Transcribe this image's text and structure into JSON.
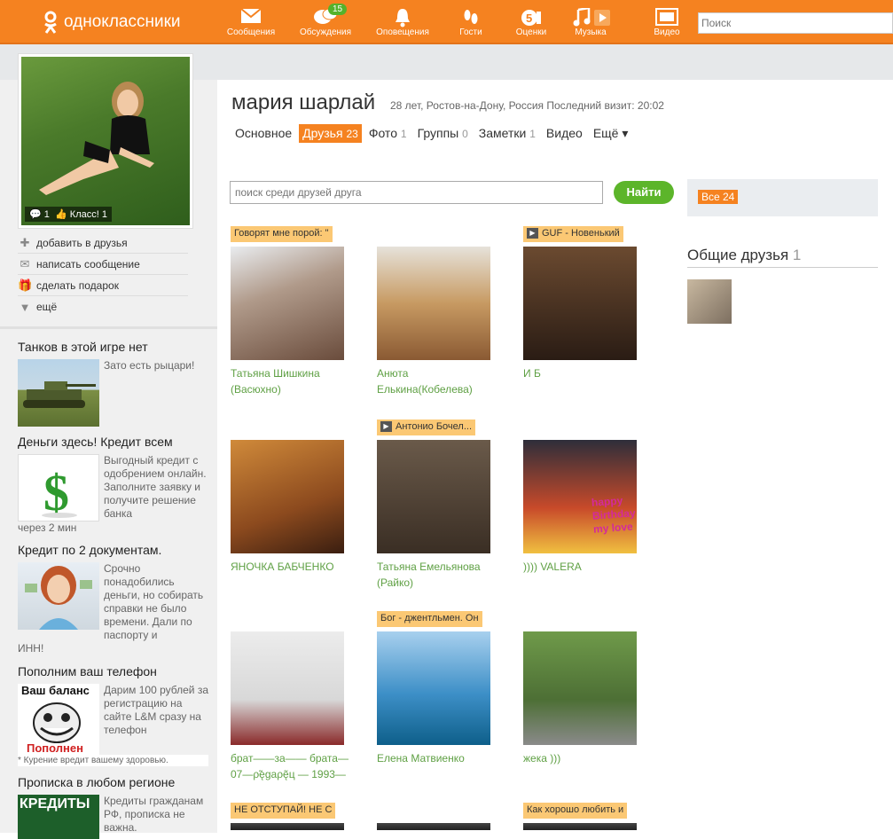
{
  "topbar": {
    "logo_text": "одноклассники",
    "nav": [
      {
        "label": "Сообщения",
        "icon": "envelope-icon"
      },
      {
        "label": "Обсуждения",
        "icon": "chat-bubbles-icon",
        "badge": "15"
      },
      {
        "label": "Оповещения",
        "icon": "bell-icon"
      },
      {
        "label": "Гости",
        "icon": "footprints-icon"
      },
      {
        "label": "Оценки",
        "icon": "rating-5-icon",
        "badge_inline": "5"
      },
      {
        "label": "Музыка",
        "icon": "music-note-icon"
      },
      {
        "label": "Видео",
        "icon": "video-icon"
      }
    ],
    "search_placeholder": "Поиск"
  },
  "profile": {
    "name": "мария шарлай",
    "meta": "28 лет, Ростов-на-Дону, Россия  Последний визит: 20:02",
    "photo_comments": "1",
    "photo_class": "Класс! 1",
    "actions": [
      {
        "label": "добавить в друзья",
        "icon": "plus-icon"
      },
      {
        "label": "написать сообщение",
        "icon": "envelope-icon"
      },
      {
        "label": "сделать подарок",
        "icon": "gift-icon"
      },
      {
        "label": "ещё",
        "icon": "triangle-down-icon"
      }
    ]
  },
  "tabs": [
    {
      "label": "Основное",
      "count": ""
    },
    {
      "label": "Друзья",
      "count": "23",
      "active": true
    },
    {
      "label": "Фото",
      "count": "1"
    },
    {
      "label": "Группы",
      "count": "0"
    },
    {
      "label": "Заметки",
      "count": "1"
    },
    {
      "label": "Видео",
      "count": ""
    },
    {
      "label": "Ещё ▾",
      "count": ""
    }
  ],
  "friend_search": {
    "placeholder": "поиск среди друзей друга",
    "button": "Найти"
  },
  "right": {
    "all_label": "Все 24",
    "common_title": "Общие друзья",
    "common_count": "1"
  },
  "friends": [
    {
      "name": "Татьяна Шишкина (Васюхно)",
      "status": "Говорят мне порой: \"",
      "play": false
    },
    {
      "name": "Анюта Елькина(Кобелева)",
      "status": "",
      "play": false
    },
    {
      "name": "И Б",
      "status": "GUF - Новенький",
      "play": true
    },
    {
      "name": "ЯНОЧКА БАБЧЕНКО",
      "status": "",
      "play": false
    },
    {
      "name": "Татьяна Емельянова (Райко)",
      "status": "Антонио Бочел...",
      "play": true
    },
    {
      "name": ")))) VALERA",
      "status": "",
      "play": false,
      "overlay": "happy Birthday my love"
    },
    {
      "name": "брат——за—— брата— 07—ρ̃ęgаρę̃ц — 1993—",
      "status": "",
      "play": false
    },
    {
      "name": "Елена Матвиенко",
      "status": "Бог - джентльмен. Он",
      "play": false
    },
    {
      "name": "жека )))",
      "status": "",
      "play": false
    },
    {
      "name": "",
      "status": "НЕ ОТСТУПАЙ! НЕ С",
      "play": false
    },
    {
      "name": "",
      "status": "",
      "play": false
    },
    {
      "name": "",
      "status": "Как хорошо любить и",
      "play": false
    }
  ],
  "ads": [
    {
      "title": "Танков в этой игре нет",
      "text": "Зато есть рыцари!",
      "extra": ""
    },
    {
      "title": "Деньги здесь! Кредит всем",
      "text": "Выгодный кредит с одобрением онлайн. Заполните заявку и получите решение банка",
      "extra": "через 2 мин"
    },
    {
      "title": "Кредит по 2 документам.",
      "text": "Срочно понадобились деньги, но собирать справки не было времени. Дали по паспорту и",
      "extra": "ИНН!"
    },
    {
      "title": "Пополним ваш телефон",
      "text": "Дарим 100 рублей за регистрацию на сайте L&M сразу на телефон",
      "extra": "* Курение вредит вашему здоровью.",
      "img_top": "Ваш баланс",
      "img_bottom": "Пополнен"
    },
    {
      "title": "Прописка в любом регионе",
      "text": "Кредиты гражданам РФ, прописка не важна.",
      "extra": "",
      "img_top": "КРЕДИТЫ"
    }
  ]
}
